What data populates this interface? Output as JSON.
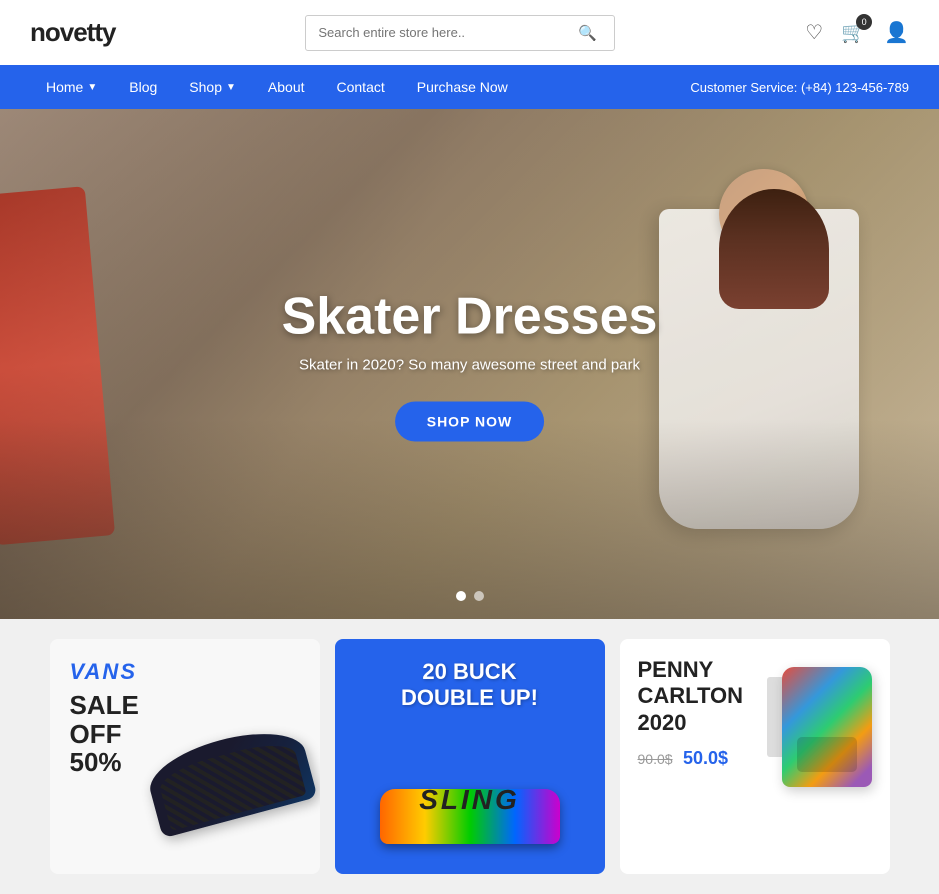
{
  "header": {
    "logo": "novetty",
    "search": {
      "placeholder": "Search entire store here..",
      "value": ""
    },
    "icons": {
      "wishlist": "♡",
      "cart": "🛒",
      "cart_count": "0",
      "account": "👤"
    }
  },
  "nav": {
    "items": [
      {
        "label": "Home",
        "has_dropdown": true
      },
      {
        "label": "Blog",
        "has_dropdown": false
      },
      {
        "label": "Shop",
        "has_dropdown": true
      },
      {
        "label": "About",
        "has_dropdown": false
      },
      {
        "label": "Contact",
        "has_dropdown": false
      },
      {
        "label": "Purchase Now",
        "has_dropdown": false
      }
    ],
    "customer_service": "Customer Service: (+84) 123-456-789"
  },
  "hero": {
    "title": "Skater Dresses",
    "subtitle": "Skater in 2020? So many awesome street and park",
    "cta_label": "SHOP NOW",
    "dots": [
      true,
      false
    ]
  },
  "cards": [
    {
      "id": "vans",
      "brand": "VANS",
      "sale_line1": "SALE",
      "sale_line2": "OFF",
      "sale_line3": "50%"
    },
    {
      "id": "buck",
      "line1": "20 BUCK",
      "line2": "DOUBLE UP!"
    },
    {
      "id": "penny",
      "title_line1": "PENNY",
      "title_line2": "CARLTON",
      "title_line3": "2020",
      "price_old": "90.0$",
      "price_new": "50.0$"
    }
  ]
}
